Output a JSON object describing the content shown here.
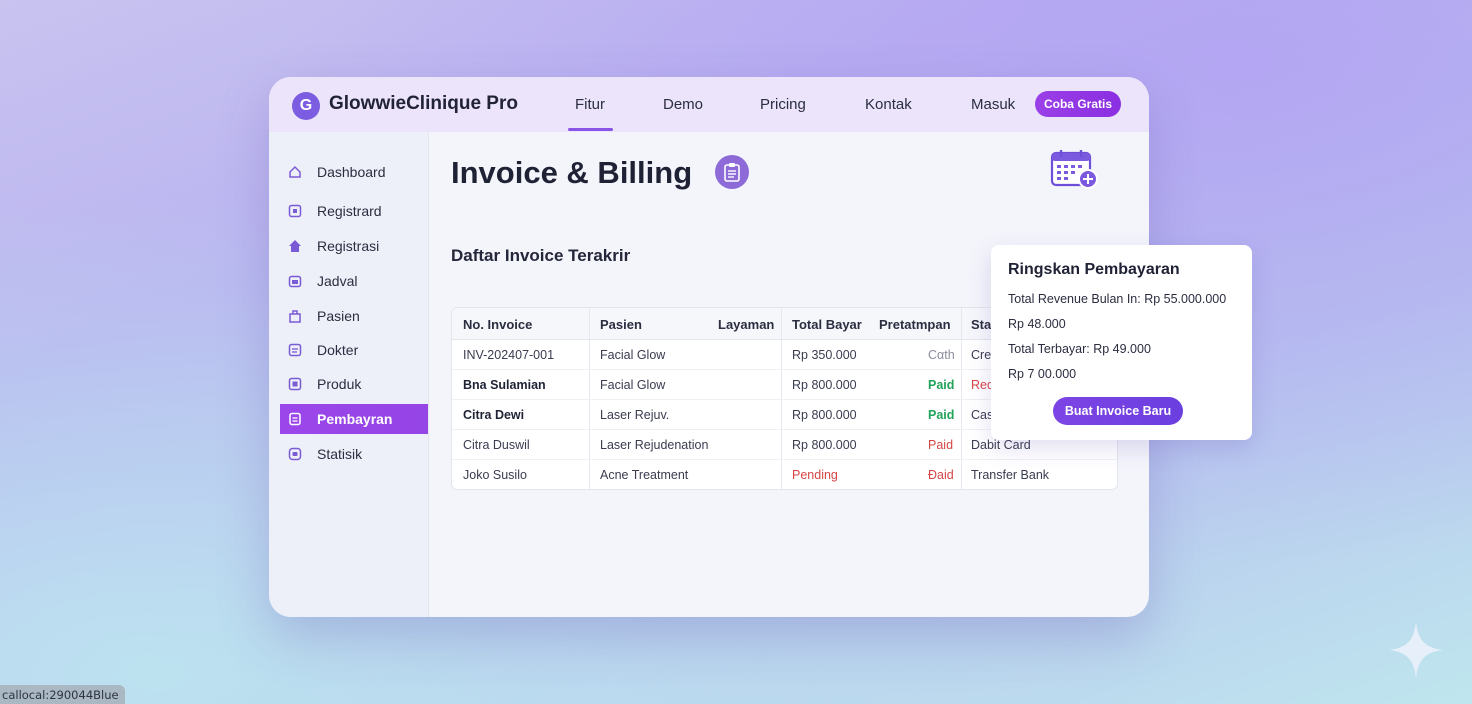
{
  "app": {
    "brand_initial": "G",
    "brand_name": "GlowwieClinique Pro"
  },
  "topnav": {
    "links": [
      "Fitur",
      "Demo",
      "Pricing",
      "Kontak",
      "Masuk"
    ],
    "active": "Fitur",
    "cta_label": "Coba Gratis"
  },
  "sidebar": {
    "items": [
      {
        "label": "Dashboard",
        "icon": "home-icon"
      },
      {
        "label": "Registrard",
        "icon": "edit-icon"
      },
      {
        "label": "Registrasi",
        "icon": "house-icon"
      },
      {
        "label": "Jadval",
        "icon": "calendar-icon"
      },
      {
        "label": "Pasien",
        "icon": "bag-icon"
      },
      {
        "label": "Dokter",
        "icon": "doc-icon"
      },
      {
        "label": "Produk",
        "icon": "box-icon"
      },
      {
        "label": "Pembayran",
        "icon": "receipt-icon",
        "active": true
      },
      {
        "label": "Statisik",
        "icon": "chart-icon"
      }
    ]
  },
  "main": {
    "page_title": "Invoice & Billing",
    "section_title": "Daftar Invoice Terakrir"
  },
  "table": {
    "headers": [
      "No. Invoice",
      "Pasien",
      "Layaman",
      "Total Bayar",
      "Pretatmpan",
      "Stat"
    ],
    "rows": [
      {
        "invoice": "INV-202407-001",
        "layanan": "Facial Glow",
        "total": "Rp 350.000",
        "status": "Cαth",
        "metode": "Cre"
      },
      {
        "invoice": "Bna Sulamian",
        "layanan": "Facial Glow",
        "total": "Rp 800.000",
        "status": "Paid",
        "metode": "Red"
      },
      {
        "invoice": "Citra Dewi",
        "layanan": "Laser Rejuv.",
        "total": "Rp 800.000",
        "status": "Paid",
        "metode": "Cas"
      },
      {
        "invoice": "Citra Duswil",
        "layanan": "Laser Rejudenation",
        "total": "Rp 800.000",
        "status": "Paid",
        "metode": "Dabit Card"
      },
      {
        "invoice": "Joko Susilo",
        "layanan": "Acne Treatment",
        "total": "Pending",
        "status": "Ðaid",
        "metode": "Transfer Bank"
      }
    ]
  },
  "summary": {
    "title": "Ringskan Pembayaran",
    "line1": "Total Revenue Bulan In: Rp 55.000.000",
    "line2": "Rp 48.000",
    "line3": "Total Terbayar: Rp 49.000",
    "line4": "Rp 7 00.000",
    "button_label": "Buat Invoice Baru"
  },
  "status_chip": "callocal:290044Blue",
  "colors": {
    "accent": "#9b46ea",
    "paid": "#22a35a",
    "pending": "#d64545"
  }
}
